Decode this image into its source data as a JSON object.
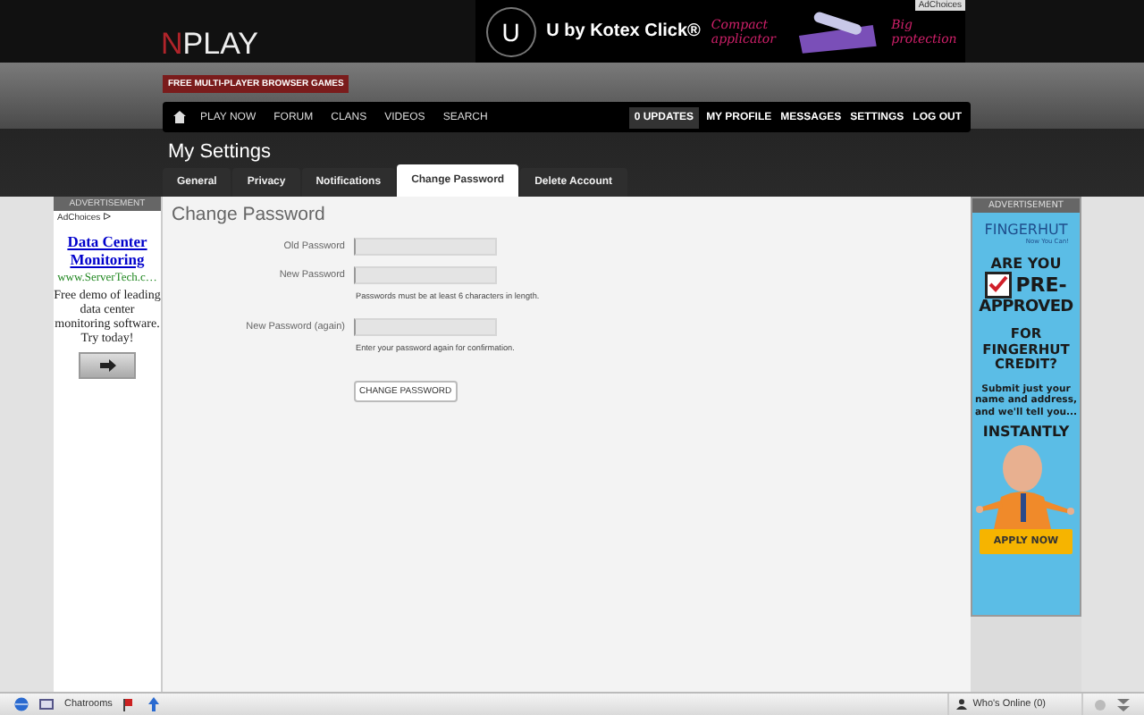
{
  "header": {
    "logo_first": "N",
    "logo_rest": "PLAY",
    "tagline": "FREE MULTI-PLAYER BROWSER GAMES"
  },
  "top_ad": {
    "logo_letter": "U",
    "brand": "U by Kotex Click®",
    "callouts": [
      "Compact applicator",
      "Big protection"
    ],
    "adchoices": "AdChoices"
  },
  "nav": {
    "items": [
      "PLAY NOW",
      "FORUM",
      "CLANS",
      "VIDEOS",
      "SEARCH"
    ],
    "updates": "0 UPDATES",
    "user_items": [
      "MY PROFILE",
      "MESSAGES",
      "SETTINGS",
      "LOG OUT"
    ]
  },
  "page_title": "My Settings",
  "tabs": [
    {
      "label": "General",
      "selected": false
    },
    {
      "label": "Privacy",
      "selected": false
    },
    {
      "label": "Notifications",
      "selected": false
    },
    {
      "label": "Change Password",
      "selected": true
    },
    {
      "label": "Delete Account",
      "selected": false
    }
  ],
  "form": {
    "title": "Change Password",
    "fields": [
      {
        "label": "Old Password"
      },
      {
        "label": "New Password",
        "hint": "Passwords must be at least 6 characters in length."
      },
      {
        "label": "New Password (again)",
        "hint": "Enter your password again for confirmation."
      }
    ],
    "button": "CHANGE PASSWORD"
  },
  "left_ad": {
    "header": "ADVERTISEMENT",
    "adchoices": "AdChoices",
    "title": "Data Center Monitoring",
    "url": "www.ServerTech.c…",
    "body": "Free demo of leading data center monitoring software. Try today!"
  },
  "right_ad": {
    "header": "ADVERTISEMENT",
    "brand": "FINGERHUT",
    "slogan": "Now You Can!",
    "question": "ARE YOU",
    "check_word": "PRE-",
    "rest_word": "APPROVED",
    "credit": "FOR FINGERHUT CREDIT?",
    "submit": "Submit just your name and address, and we'll tell you...",
    "instantly": "INSTANTLY",
    "button": "APPLY NOW"
  },
  "bottom_bar": {
    "chatrooms": "Chatrooms",
    "whos_online": "Who's Online (0)"
  }
}
